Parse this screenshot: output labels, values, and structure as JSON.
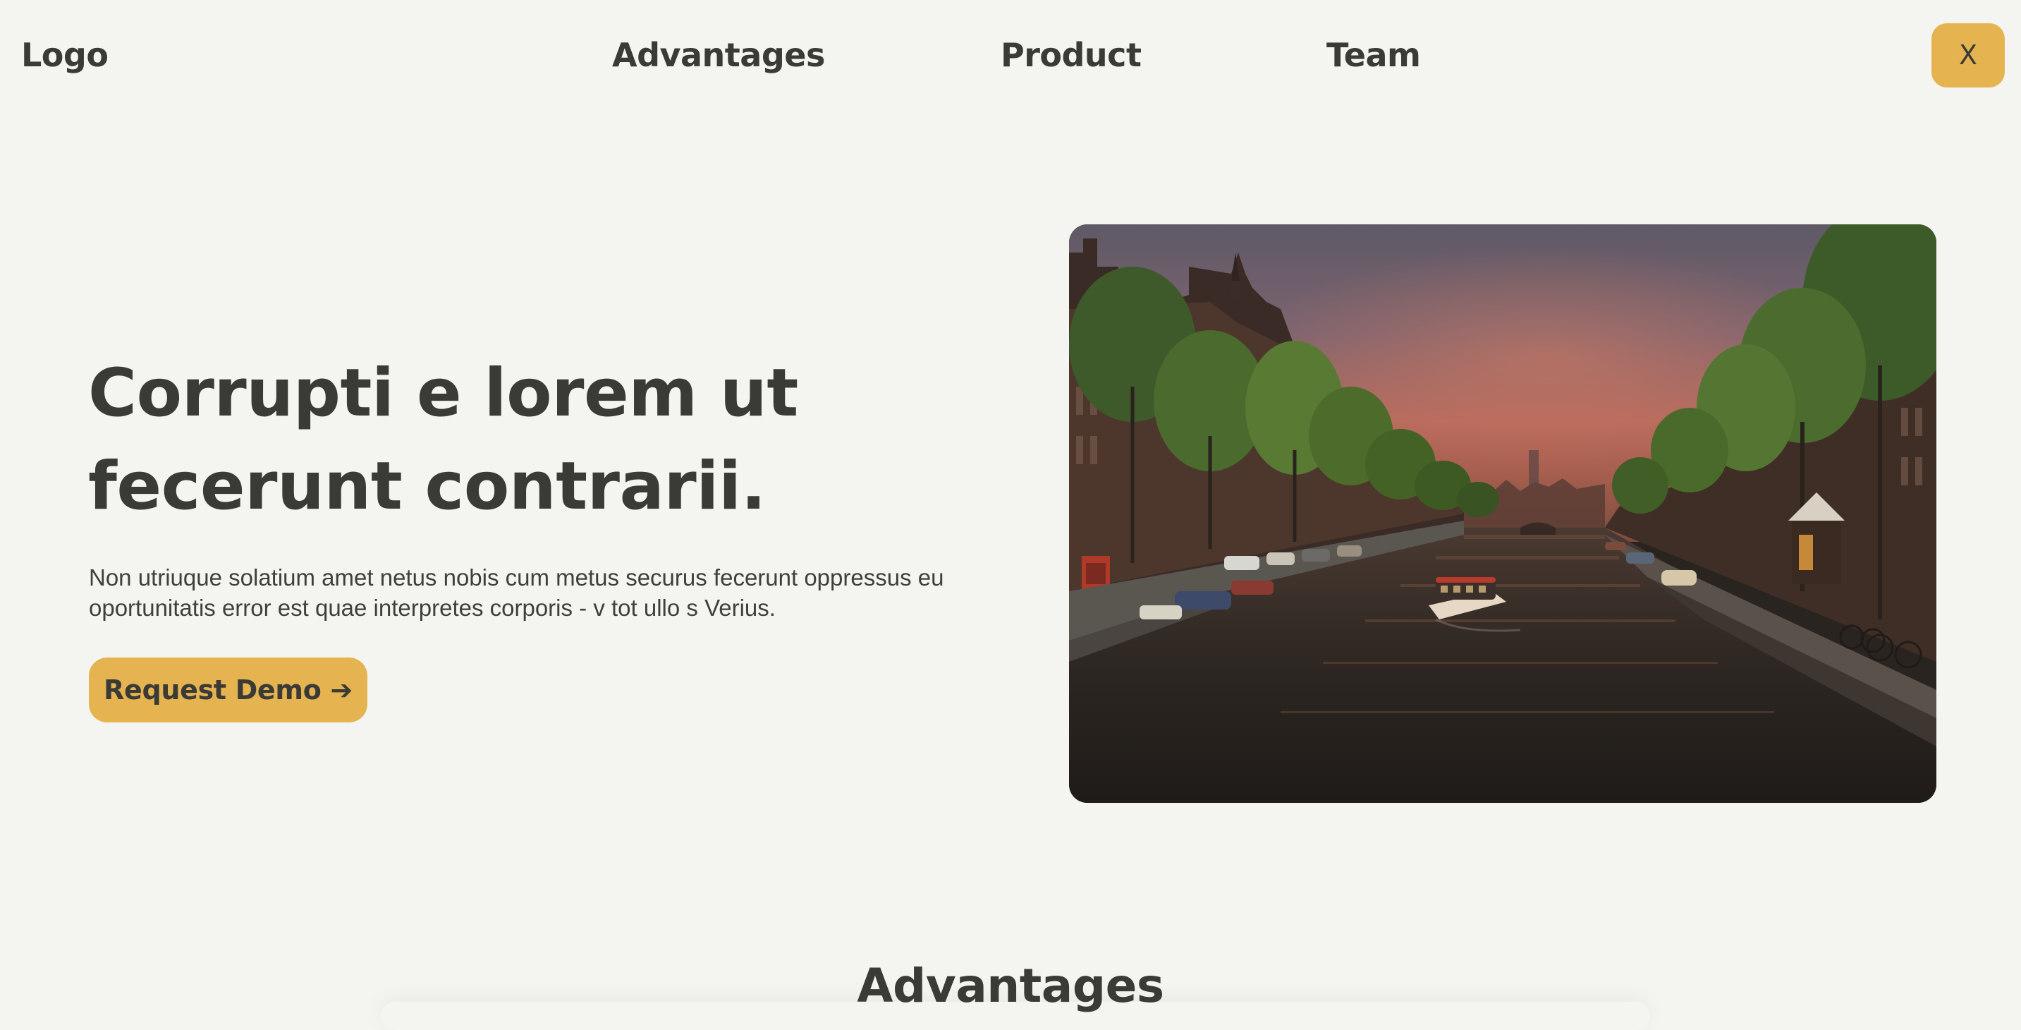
{
  "nav": {
    "logo": "Logo",
    "links": [
      "Advantages",
      "Product",
      "Team"
    ],
    "close_label": "X"
  },
  "hero": {
    "title_line1": "Corrupti e lorem ut",
    "title_line2": "fecerunt contrarii.",
    "body": "Non utriuque solatium amet netus nobis cum metus securus fecerunt oppressus eu oportunitatis error est quae interpretes corporis - v tot ullo s Verius.",
    "cta_label": "Request Demo ➔"
  },
  "sections": {
    "advantages_title": "Advantages"
  },
  "colors": {
    "background": "#f4f4f0",
    "accent": "#e5b450",
    "text": "#3a3a37"
  }
}
